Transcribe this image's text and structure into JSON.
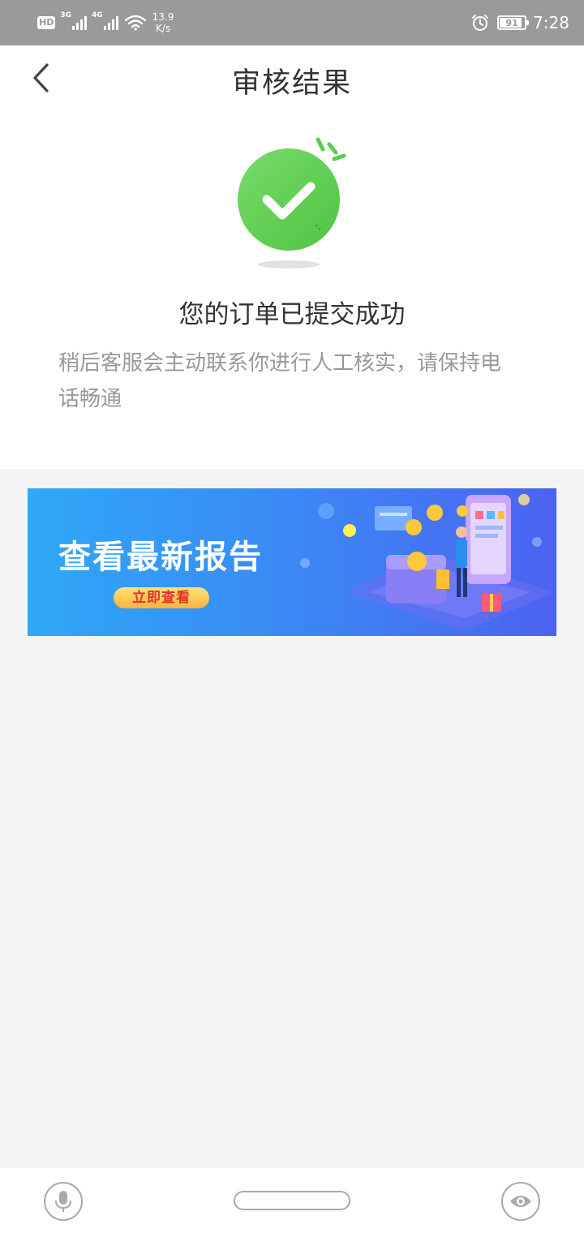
{
  "status_bar": {
    "hd": "HD",
    "net1": "3G",
    "net2": "4G",
    "speed_value": "13.9",
    "speed_unit": "K/s",
    "battery": "91",
    "battery_level": 0.91,
    "time": "7:28",
    "icons": [
      "signal-icon",
      "wifi-icon",
      "alarm-icon",
      "battery-icon"
    ]
  },
  "header": {
    "title": "审核结果",
    "back_icon": "chevron-left-icon"
  },
  "result": {
    "icon": "success-check-icon",
    "title": "您的订单已提交成功",
    "description": "稍后客服会主动联系你进行人工核实，请保持电话畅通"
  },
  "banner": {
    "title": "查看最新报告",
    "button": "立即查看",
    "colors": {
      "start": "#2fa8f6",
      "end": "#4b63f1",
      "button_text": "#e0352b"
    }
  },
  "nav_bar": {
    "icons": [
      "microphone-icon",
      "home-pill",
      "eye-icon"
    ]
  },
  "colors": {
    "success_green": "#5cce4e",
    "page_background": "#f4f4f5",
    "status_bar": "#9a9a9a"
  }
}
